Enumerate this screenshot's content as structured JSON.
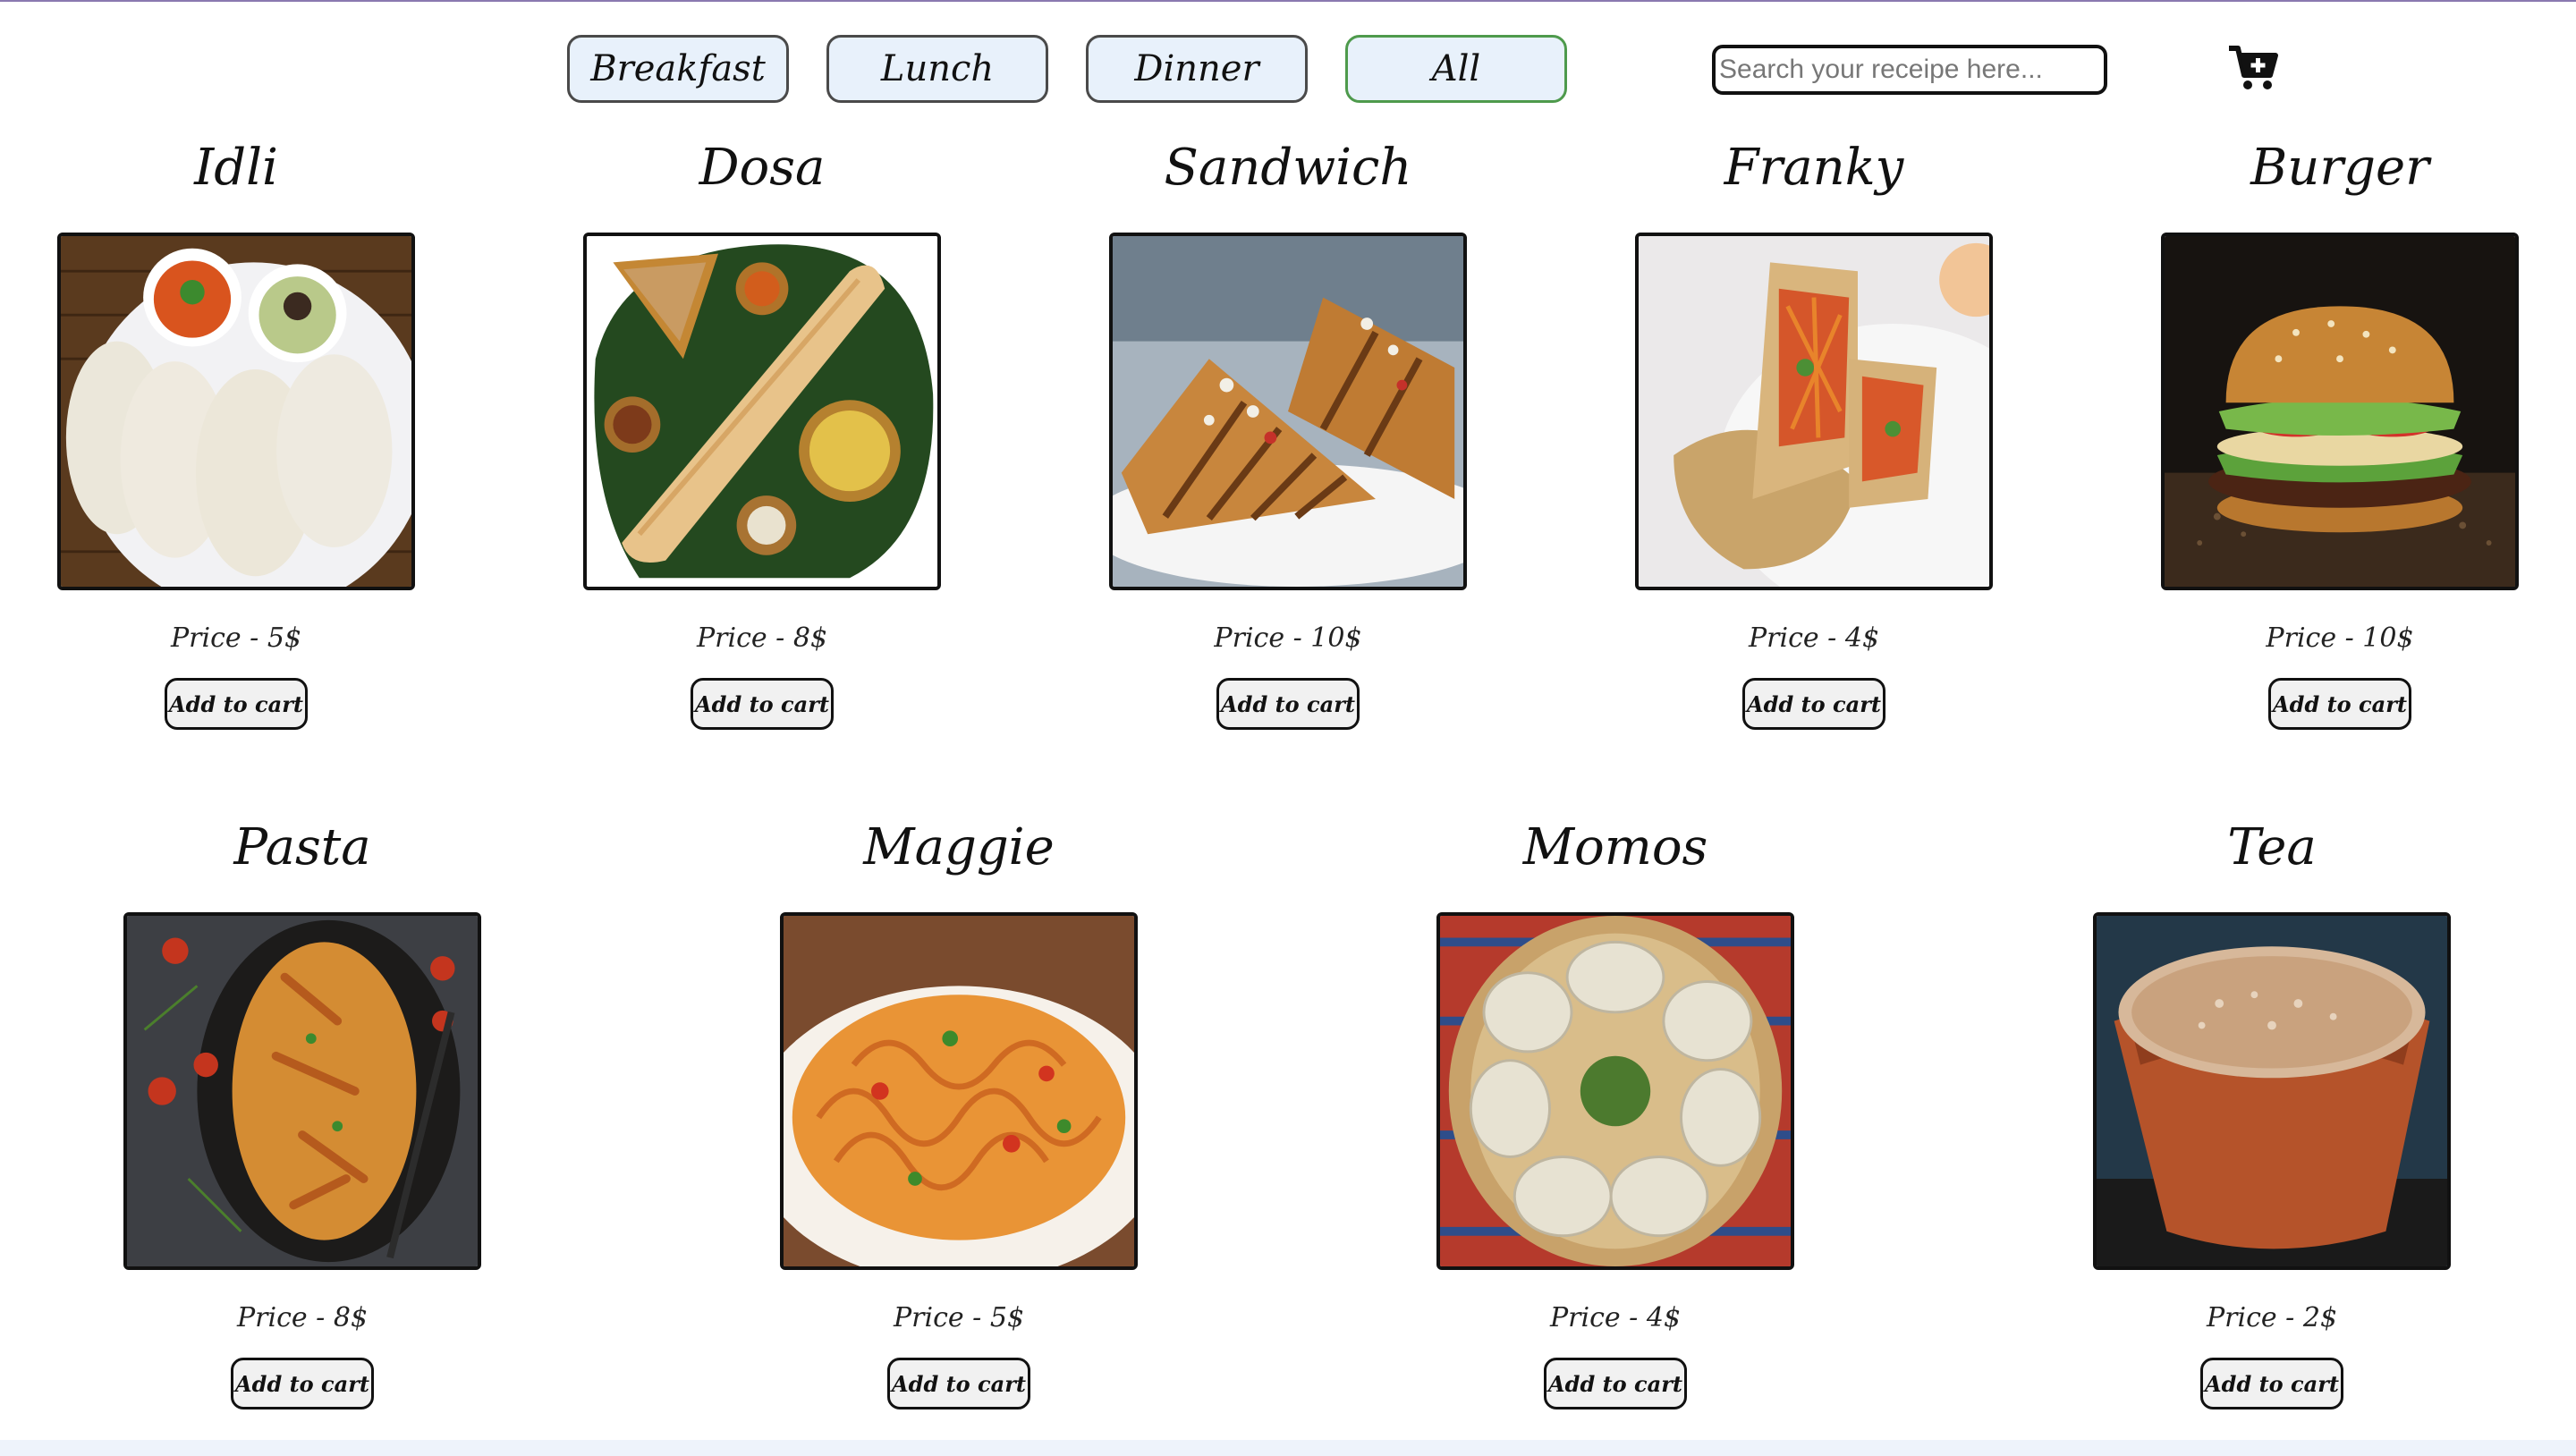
{
  "nav": {
    "breakfast": "Breakfast",
    "lunch": "Lunch",
    "dinner": "Dinner",
    "all": "All"
  },
  "search": {
    "placeholder": "Search your receipe here..."
  },
  "cart": {
    "icon": "cart-plus-icon"
  },
  "items": [
    {
      "name": "Idli",
      "price": "Price - 5$",
      "button": "Add to cart"
    },
    {
      "name": "Dosa",
      "price": "Price - 8$",
      "button": "Add to cart"
    },
    {
      "name": "Sandwich",
      "price": "Price - 10$",
      "button": "Add to cart"
    },
    {
      "name": "Franky",
      "price": "Price - 4$",
      "button": "Add to cart"
    },
    {
      "name": "Burger",
      "price": "Price - 10$",
      "button": "Add to cart"
    },
    {
      "name": "Pasta",
      "price": "Price - 8$",
      "button": "Add to cart"
    },
    {
      "name": "Maggie",
      "price": "Price - 5$",
      "button": "Add to cart"
    },
    {
      "name": "Momos",
      "price": "Price - 4$",
      "button": "Add to cart"
    },
    {
      "name": "Tea",
      "price": "Price - 2$",
      "button": "Add to cart"
    }
  ],
  "colors": {
    "nav_bg": "#e8f1fb",
    "active_border": "#4e9a4c"
  }
}
